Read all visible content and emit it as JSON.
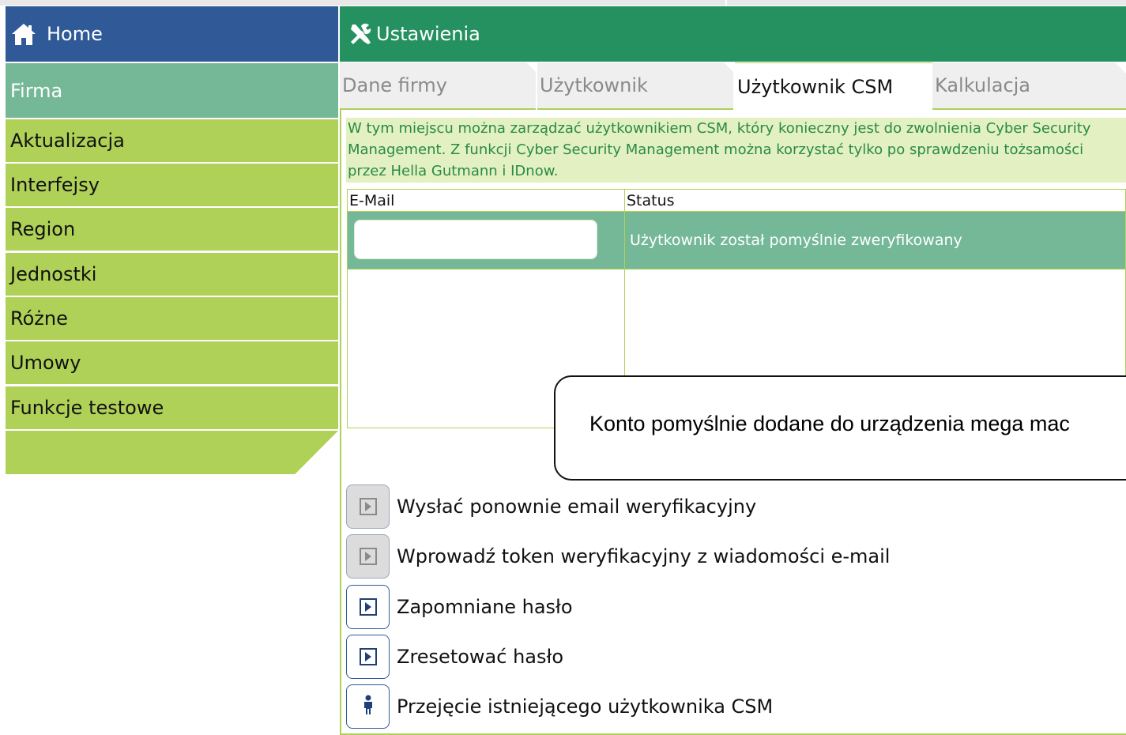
{
  "sidebar": {
    "home_label": "Home",
    "items": [
      {
        "label": "Firma",
        "active": true
      },
      {
        "label": "Aktualizacja"
      },
      {
        "label": "Interfejsy"
      },
      {
        "label": "Region"
      },
      {
        "label": "Jednostki"
      },
      {
        "label": "Różne"
      },
      {
        "label": "Umowy"
      },
      {
        "label": "Funkcje testowe"
      }
    ]
  },
  "header": {
    "title": "Ustawienia",
    "icon": "tools-icon"
  },
  "tabs": [
    {
      "label": "Dane firmy",
      "active": false
    },
    {
      "label": "Użytkownik",
      "active": false
    },
    {
      "label": "Użytkownik CSM",
      "active": true
    },
    {
      "label": "Kalkulacja",
      "active": false
    }
  ],
  "info_text": "W tym miejscu można zarządzać użytkownikiem CSM, który konieczny jest do zwolnienia Cyber Security Management. Z funkcji Cyber Security Management można korzystać tylko po sprawdzeniu tożsamości przez Hella Gutmann i IDnow.",
  "table": {
    "columns": [
      "E-Mail",
      "Status"
    ],
    "rows": [
      {
        "email": "",
        "status": "Użytkownik został pomyślnie zweryfikowany"
      }
    ]
  },
  "toast": {
    "message": "Konto pomyślnie dodane do urządzenia mega mac"
  },
  "actions": [
    {
      "label": "Wysłać ponownie email weryfikacyjny",
      "icon": "play-icon",
      "enabled": false
    },
    {
      "label": "Wprowadź token weryfikacyjny z wiadomości e-mail",
      "icon": "play-icon",
      "enabled": false
    },
    {
      "label": "Zapomniane hasło",
      "icon": "play-icon",
      "enabled": true
    },
    {
      "label": "Zresetować hasło",
      "icon": "play-icon",
      "enabled": true
    },
    {
      "label": "Przejęcie istniejącego użytkownika CSM",
      "icon": "person-icon",
      "enabled": true
    }
  ],
  "colors": {
    "home_blue": "#2f5a97",
    "header_green": "#259160",
    "menu_lime": "#afd157",
    "active_teal": "#74b897",
    "info_bg": "#e2f0c2",
    "info_text": "#2a8a45"
  }
}
